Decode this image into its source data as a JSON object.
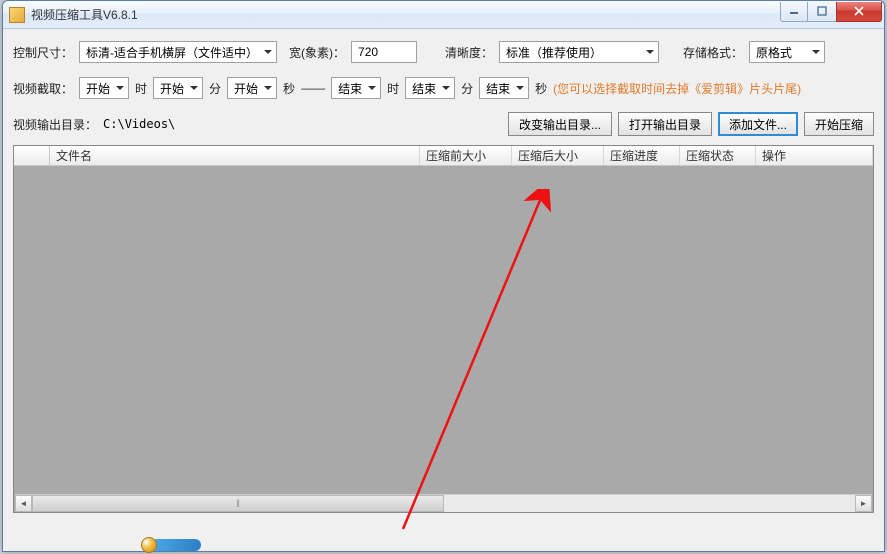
{
  "window": {
    "title": "视频压缩工具V6.8.1"
  },
  "row1": {
    "size_label": "控制尺寸：",
    "size_preset": "标清-适合手机横屏（文件适中）",
    "width_label": "宽(象素)：",
    "width_value": "720",
    "clarity_label": "清晰度：",
    "clarity_value": "标准（推荐使用）",
    "format_label": "存储格式：",
    "format_value": "原格式"
  },
  "row2": {
    "trim_label": "视频截取：",
    "start_h": "开始",
    "unit_h": "时",
    "start_m": "开始",
    "unit_m": "分",
    "start_s": "开始",
    "unit_s": "秒",
    "sep": "——",
    "end_h": "结束",
    "end_m": "结束",
    "end_s": "结束",
    "hint": "(您可以选择截取时间去掉《爱剪辑》片头片尾)"
  },
  "row3": {
    "out_label": "视频输出目录：",
    "out_path": "C:\\Videos\\",
    "btn_change": "改变输出目录...",
    "btn_open": "打开输出目录",
    "btn_add": "添加文件...",
    "btn_start": "开始压缩"
  },
  "grid": {
    "col_rowhdr": "",
    "col_name": "文件名",
    "col_before": "压缩前大小",
    "col_after": "压缩后大小",
    "col_progress": "压缩进度",
    "col_status": "压缩状态",
    "col_action": "操作"
  }
}
